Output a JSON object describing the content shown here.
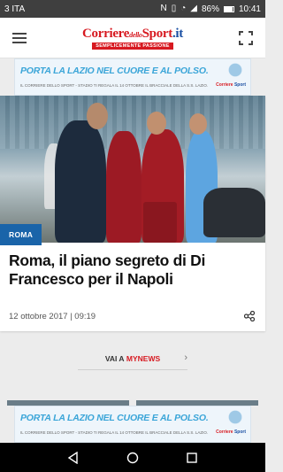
{
  "status_bar": {
    "carrier": "3 ITA",
    "battery": "86%",
    "battery_level": 0.86,
    "time": "10:41"
  },
  "app_bar": {
    "logo_name": "Corriere",
    "logo_small": "dello",
    "logo_name2": "Sport",
    "logo_suffix": ".it",
    "logo_tagline": "SEMPLICEMENTE PASSIONE"
  },
  "ad_banner": {
    "headline": "PORTA LA LAZIO NEL CUORE E AL POLSO.",
    "fine_print": "IL CORRIERE DELLO SPORT - STADIO TI REGALA IL 14 OTTOBRE IL BRACCIALE DELLA S.S. LAZIO.",
    "logo_a": "Corriere",
    "logo_b": "Sport"
  },
  "article": {
    "category": "ROMA",
    "title": "Roma, il piano segreto di Di Francesco per il Napoli",
    "date": "12 ottobre 2017 | 09:19"
  },
  "mynews": {
    "label_prefix": "VAI A",
    "label_highlight": "MYNEWS",
    "chevron": "›"
  },
  "colors": {
    "brand_red": "#d71920",
    "badge_blue": "#1a64a9",
    "ad_blue": "#3aa5d8"
  }
}
